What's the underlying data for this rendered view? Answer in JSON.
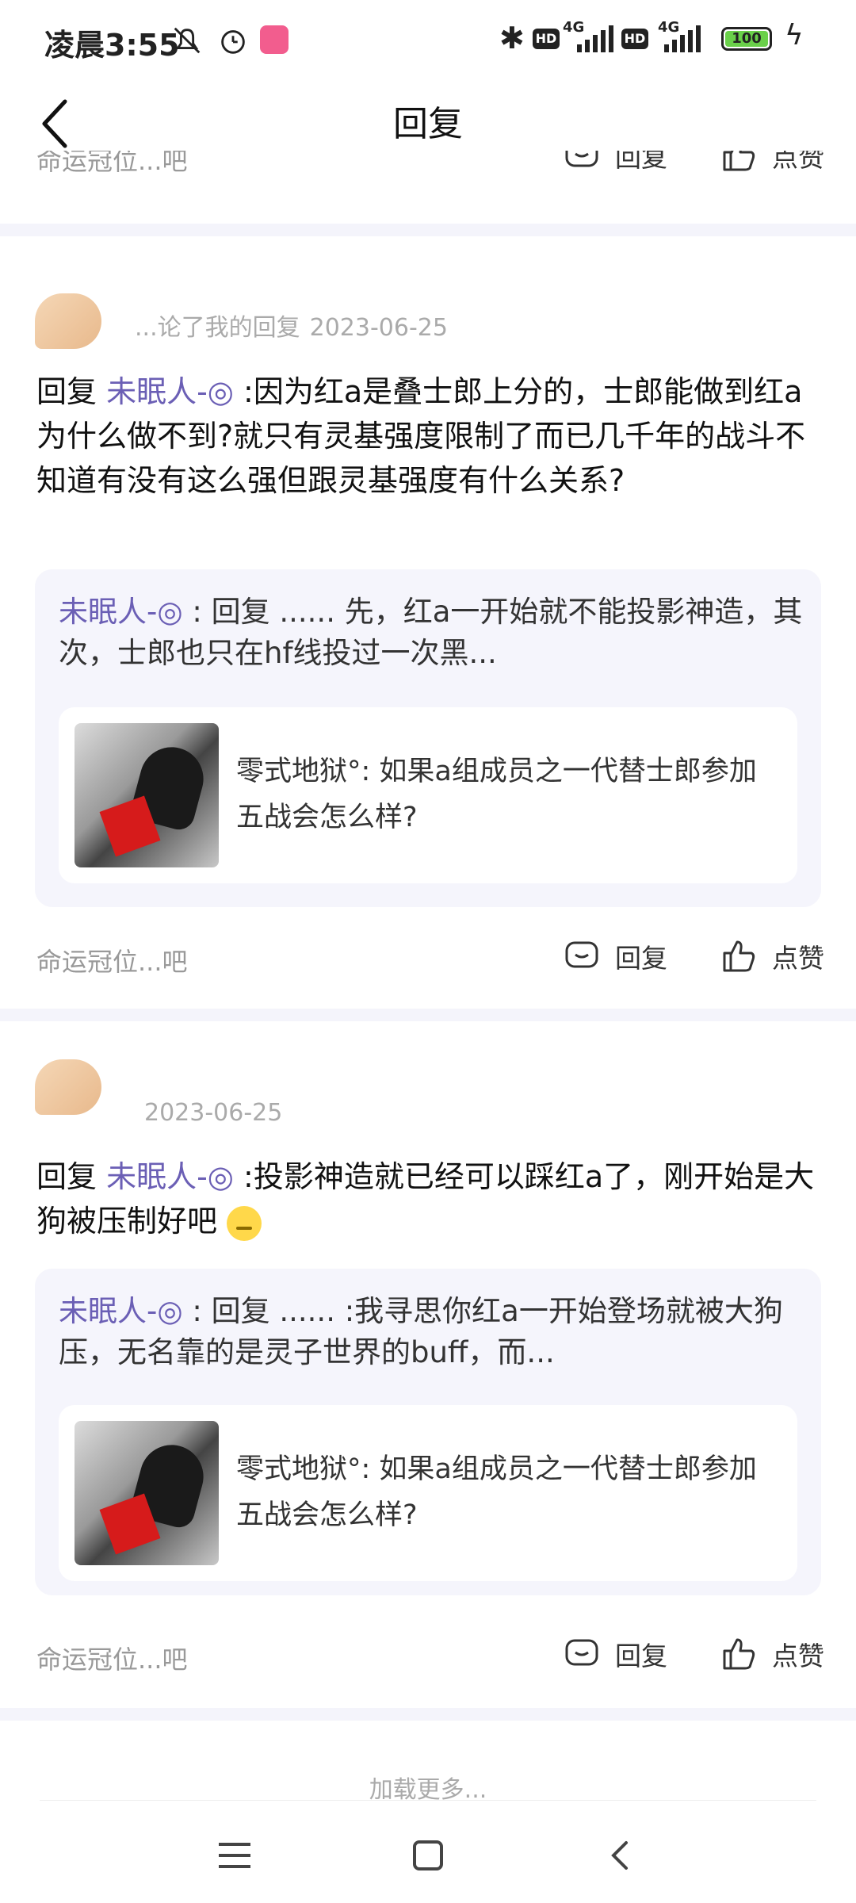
{
  "status_bar": {
    "time": "凌晨3:55",
    "hd1": "HD",
    "net1": "4G",
    "hd2": "HD",
    "net2": "4G",
    "battery": "100"
  },
  "nav": {
    "title": "回复"
  },
  "common": {
    "forum_name": "命运冠位...吧",
    "reply_label": "回复",
    "like_label": "点赞",
    "load_more": "加载更多..."
  },
  "comments": [
    {
      "meta": "...论了我的回复",
      "date": "2023-06-25",
      "reply_prefix": "回复 ",
      "mention": "未眠人-◎",
      "text": " :因为红a是叠士郎上分的，士郎能做到红a为什么做不到?就只有灵基强度限制了而已几千年的战斗不知道有没有这么强但跟灵基强度有什么关系?",
      "quote_author": "未眠人-◎",
      "quote_text": " : 回复 ...... 先，红a一开始就不能投影神造，其次，士郎也只在hf线投过一次黑...",
      "post_title": "零式地狱°: 如果a组成员之一代替士郎参加五战会怎么样?"
    },
    {
      "meta": "",
      "date": "2023-06-25",
      "reply_prefix": "回复 ",
      "mention": "未眠人-◎",
      "text": " :投影神造就已经可以踩红a了，刚开始是大狗被压制好吧",
      "quote_author": "未眠人-◎",
      "quote_text": " : 回复 ...... :我寻思你红a一开始登场就被大狗压，无名靠的是灵子世界的buff，而...",
      "post_title": "零式地狱°: 如果a组成员之一代替士郎参加五战会怎么样?"
    }
  ]
}
